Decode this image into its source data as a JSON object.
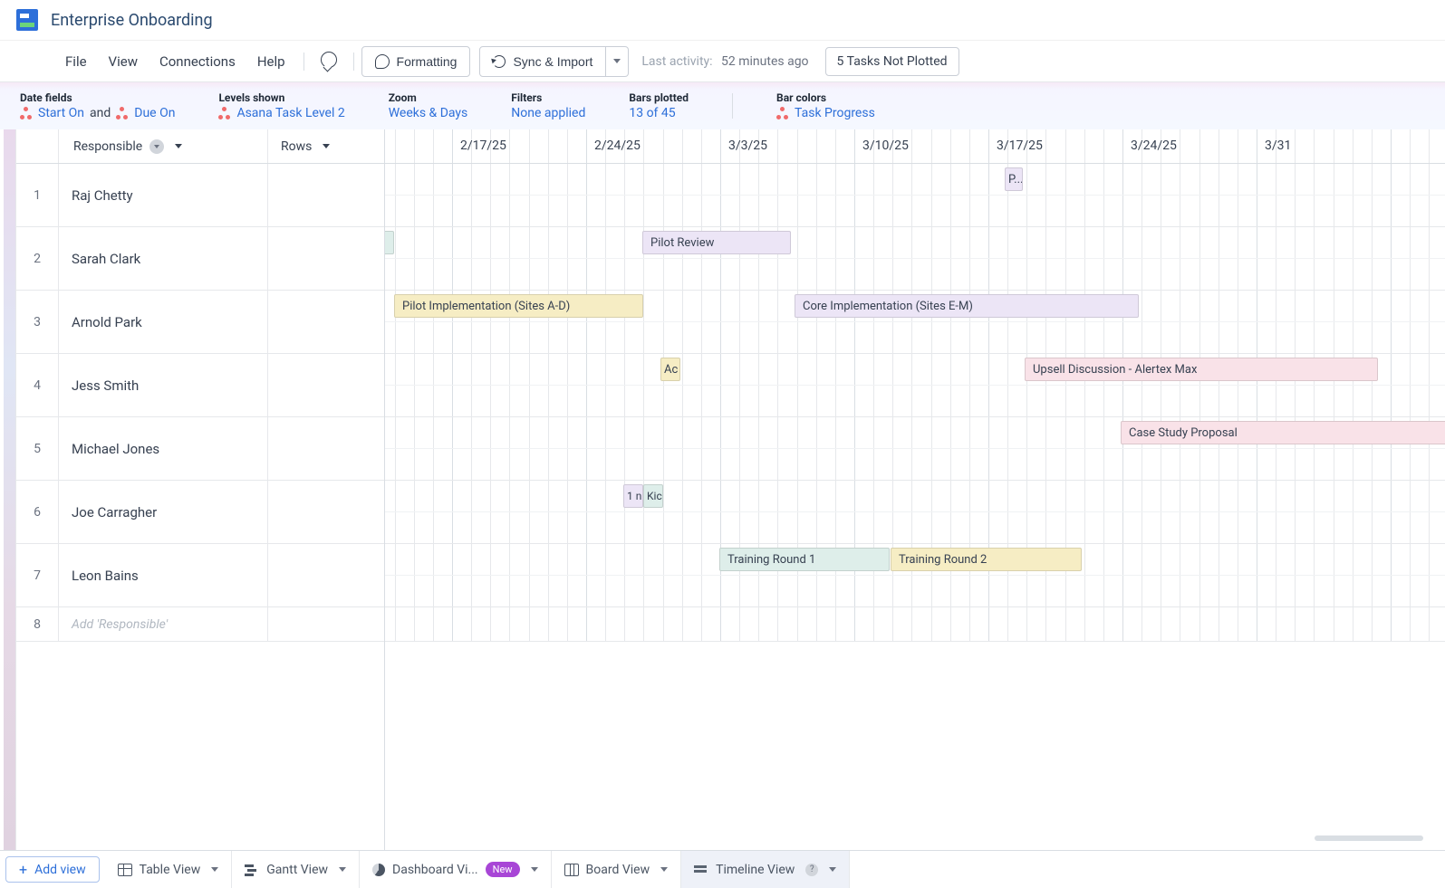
{
  "header": {
    "project_title": "Enterprise Onboarding"
  },
  "menubar": {
    "file": "File",
    "view": "View",
    "connections": "Connections",
    "help": "Help",
    "formatting": "Formatting",
    "sync_import": "Sync & Import",
    "last_activity_label": "Last activity:",
    "last_activity_value": "52 minutes ago",
    "not_plotted": "5 Tasks Not Plotted"
  },
  "configbar": {
    "date_fields": {
      "label": "Date fields",
      "start": "Start On",
      "and": "and",
      "due": "Due On"
    },
    "levels": {
      "label": "Levels shown",
      "value": "Asana Task Level 2"
    },
    "zoom": {
      "label": "Zoom",
      "value": "Weeks & Days"
    },
    "filters": {
      "label": "Filters",
      "value": "None applied"
    },
    "bars_plotted": {
      "label": "Bars plotted",
      "value": "13 of 45"
    },
    "bar_colors": {
      "label": "Bar colors",
      "value": "Task Progress"
    }
  },
  "grid": {
    "responsible_header": "Responsible",
    "rows_header": "Rows",
    "add_placeholder": "Add 'Responsible'",
    "rows": [
      {
        "num": "1",
        "name": "Raj Chetty"
      },
      {
        "num": "2",
        "name": "Sarah Clark"
      },
      {
        "num": "3",
        "name": "Arnold Park"
      },
      {
        "num": "4",
        "name": "Jess Smith"
      },
      {
        "num": "5",
        "name": "Michael Jones"
      },
      {
        "num": "6",
        "name": "Joe Carragher"
      },
      {
        "num": "7",
        "name": "Leon Bains"
      },
      {
        "num": "8",
        "name": ""
      }
    ]
  },
  "timeline": {
    "dates": [
      "2/17/25",
      "2/24/25",
      "3/3/25",
      "3/10/25",
      "3/17/25",
      "3/24/25",
      "3/31"
    ],
    "bars": {
      "r1_p": "P...",
      "r2_pilot_review": "Pilot Review",
      "r3_pilot_impl": "Pilot Implementation (Sites A-D)",
      "r3_core_impl": "Core Implementation (Sites E-M)",
      "r4_ac": "Ac",
      "r4_upsell": "Upsell Discussion - Alertex Max",
      "r5_case": "Case Study Proposal",
      "r6_1n": "1 n",
      "r6_kic": "Kic",
      "r7_t1": "Training Round 1",
      "r7_t2": "Training Round 2"
    }
  },
  "footer": {
    "add_view": "Add view",
    "tabs": {
      "table": "Table View",
      "gantt": "Gantt View",
      "dashboard": "Dashboard Vi...",
      "dashboard_badge": "New",
      "board": "Board View",
      "timeline": "Timeline View"
    }
  }
}
